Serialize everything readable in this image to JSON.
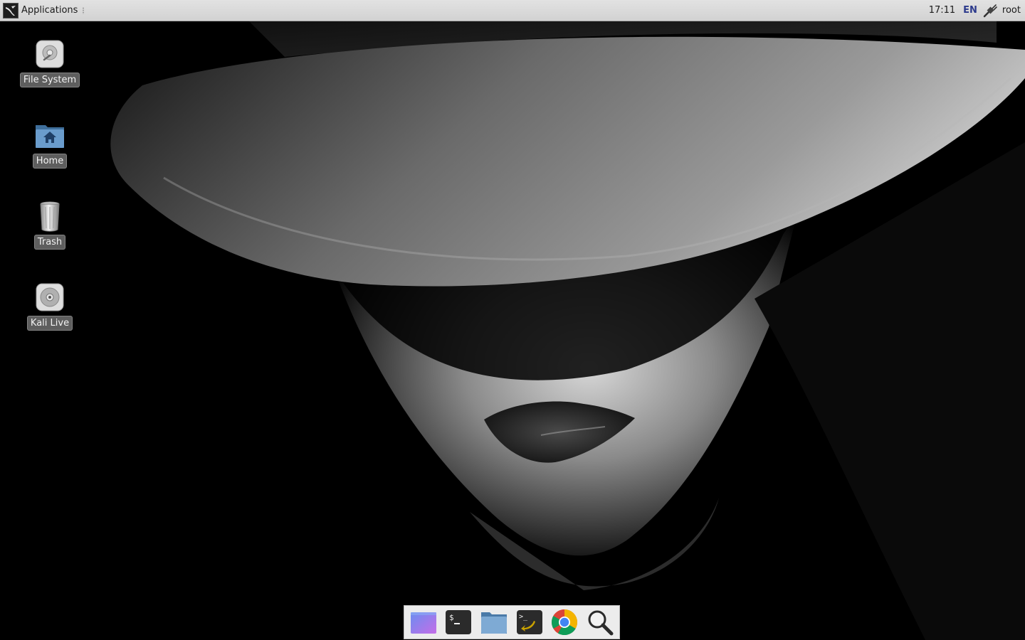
{
  "panel": {
    "applications_label": "Applications",
    "clock": "17:11",
    "keyboard_layout": "EN",
    "user": "root"
  },
  "desktop": {
    "icons": [
      {
        "label": "File System",
        "icon": "hard-drive-icon"
      },
      {
        "label": "Home",
        "icon": "home-folder-icon"
      },
      {
        "label": "Trash",
        "icon": "trash-icon"
      },
      {
        "label": "Kali Live",
        "icon": "optical-disc-icon"
      }
    ]
  },
  "dock": {
    "items": [
      {
        "icon": "show-desktop-icon"
      },
      {
        "icon": "terminal-icon"
      },
      {
        "icon": "file-manager-icon"
      },
      {
        "icon": "root-terminal-icon"
      },
      {
        "icon": "chrome-icon"
      },
      {
        "icon": "search-icon"
      }
    ]
  },
  "colors": {
    "panel_bg": "#d9d9d9",
    "dock_bg": "#ececec",
    "label_bg": "#6e6e6e",
    "keyboard_layout_color": "#2c3a8c"
  }
}
